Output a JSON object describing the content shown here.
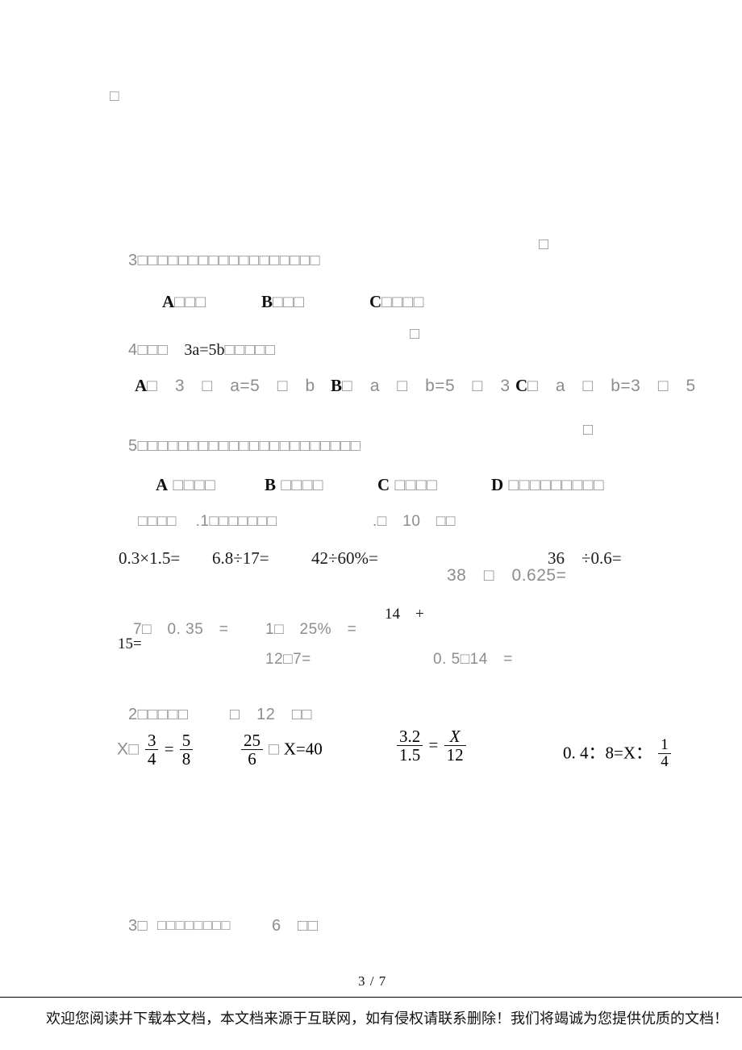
{
  "document": {
    "page_number": "3 / 7",
    "top_marker": "□"
  },
  "questions": [
    {
      "id": "q3",
      "stem": "3□□□□□□□□□□□□□□□□□□",
      "answer_mark": "□",
      "options": [
        {
          "letter": "A",
          "text": "□□□"
        },
        {
          "letter": "B",
          "text": "□□□"
        },
        {
          "letter": "C",
          "text": "□□□□"
        }
      ]
    },
    {
      "id": "q4",
      "stem_prefix": "4□□□",
      "stem_math": "3a=5b",
      "stem_suffix": "□□□□□",
      "answer_mark": "□",
      "options": [
        {
          "letter": "A",
          "text": "□　3　□　a=5　□　b"
        },
        {
          "letter": "B",
          "text": "□　a　□　b=5　□　3"
        },
        {
          "letter": "C",
          "text": "□　a　□　b=3　□　5"
        }
      ]
    },
    {
      "id": "q5",
      "stem": "5□□□□□□□□□□□□□□□□□□□□□□",
      "answer_mark": "□",
      "options": [
        {
          "letter": "A",
          "text": "□□□□"
        },
        {
          "letter": "B",
          "text": "□□□□"
        },
        {
          "letter": "C",
          "text": "□□□□"
        },
        {
          "letter": "D",
          "text": "□□□□□□□□□"
        }
      ]
    }
  ],
  "sections": [
    {
      "id": "section-calc",
      "label_prefix": "□□□□",
      "label_mid": ".1□□□□□□□",
      "label_score": ".□　10　□□"
    },
    {
      "id": "section-solve",
      "label": "2□□□□□",
      "score": "□　12　□□"
    },
    {
      "id": "section-3",
      "label": "3□",
      "body": "□□□□□□□□",
      "score": "6　□□"
    }
  ],
  "oral_calc": {
    "row1": [
      "0.3×1.5=",
      "6.8÷17=",
      "42÷60%=",
      "38　□　0.625=",
      "36　÷0.6="
    ],
    "row2": [
      "7□　0. 35　=",
      "1□　25%　=",
      "14　+"
    ],
    "row3": [
      "15=",
      "12□7=",
      "0. 5□14　="
    ]
  },
  "equations": [
    {
      "id": "eq1",
      "lead": "X□",
      "num1": "3",
      "den1": "4",
      "rel": "=",
      "num2": "5",
      "den2": "8"
    },
    {
      "id": "eq2",
      "num1": "25",
      "den1": "6",
      "mid": "□",
      "tail": "X=40"
    },
    {
      "id": "eq3",
      "num1": "3.2",
      "den1": "1.5",
      "rel": "=",
      "num2": "X",
      "den2": "12"
    },
    {
      "id": "eq4",
      "lead": "0. 4：8=X：",
      "num1": "1",
      "den1": "4"
    }
  ],
  "footer": {
    "text": "欢迎您阅读并下载本文档，本文档来源于互联网，如有侵权请联系删除！我们将竭诚为您提供优质的文档！"
  }
}
